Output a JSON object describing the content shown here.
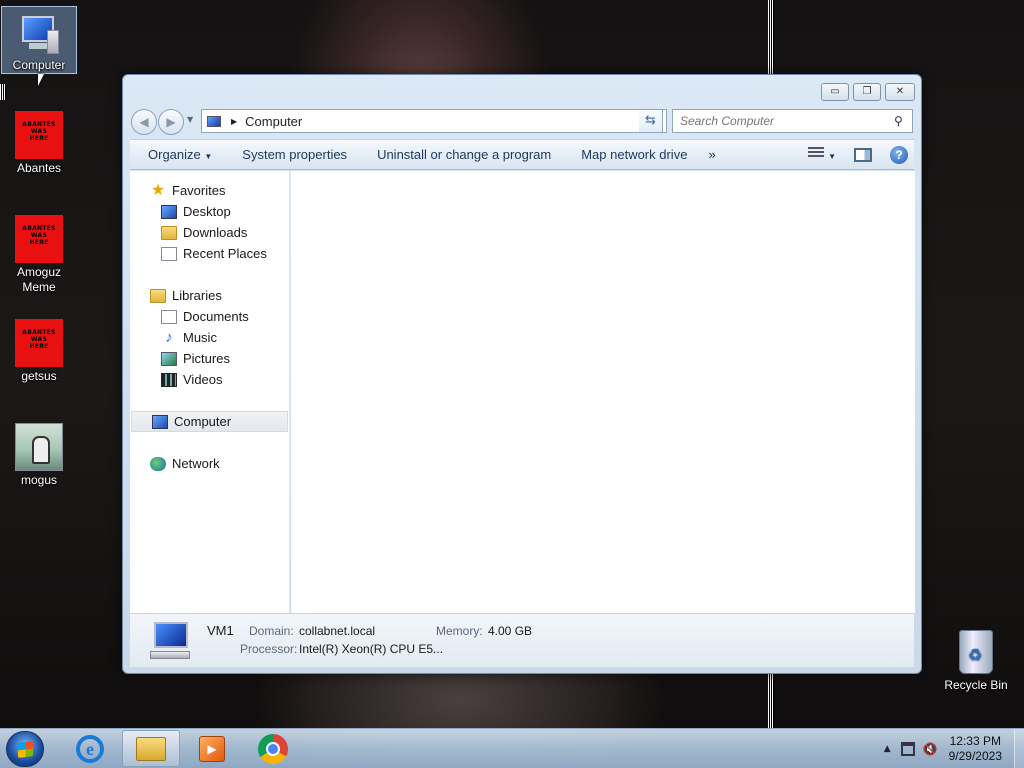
{
  "desktop": {
    "icons": [
      {
        "label": "Computer"
      },
      {
        "label": "Abantes",
        "art_text": "ABANTES\nWAS\nHERE"
      },
      {
        "label": "Amoguz\nMeme",
        "art_text": "ABANTES\nWAS\nHERE"
      },
      {
        "label": "getsus",
        "art_text": "ABANTES\nWAS\nHERE"
      },
      {
        "label": "mogus"
      }
    ],
    "recycle_bin": "Recycle Bin"
  },
  "window": {
    "controls": {
      "minimize": "▭",
      "maximize": "❐",
      "close": "✕"
    },
    "address": {
      "location": "Computer"
    },
    "search": {
      "placeholder": "Search Computer"
    },
    "toolbar": {
      "organize": "Organize",
      "system_properties": "System properties",
      "uninstall": "Uninstall or change a program",
      "map_drive": "Map network drive",
      "more": "»"
    },
    "nav": {
      "favorites": "Favorites",
      "desktop": "Desktop",
      "downloads": "Downloads",
      "recent_places": "Recent Places",
      "libraries": "Libraries",
      "documents": "Documents",
      "music": "Music",
      "pictures": "Pictures",
      "videos": "Videos",
      "computer": "Computer",
      "network": "Network"
    },
    "details": {
      "name": "VM1",
      "domain_label": "Domain:",
      "domain": "collabnet.local",
      "memory_label": "Memory:",
      "memory": "4.00 GB",
      "processor_label": "Processor:",
      "processor": "Intel(R) Xeon(R) CPU E5..."
    }
  },
  "taskbar": {
    "clock_time": "12:33 PM",
    "clock_date": "9/29/2023"
  }
}
